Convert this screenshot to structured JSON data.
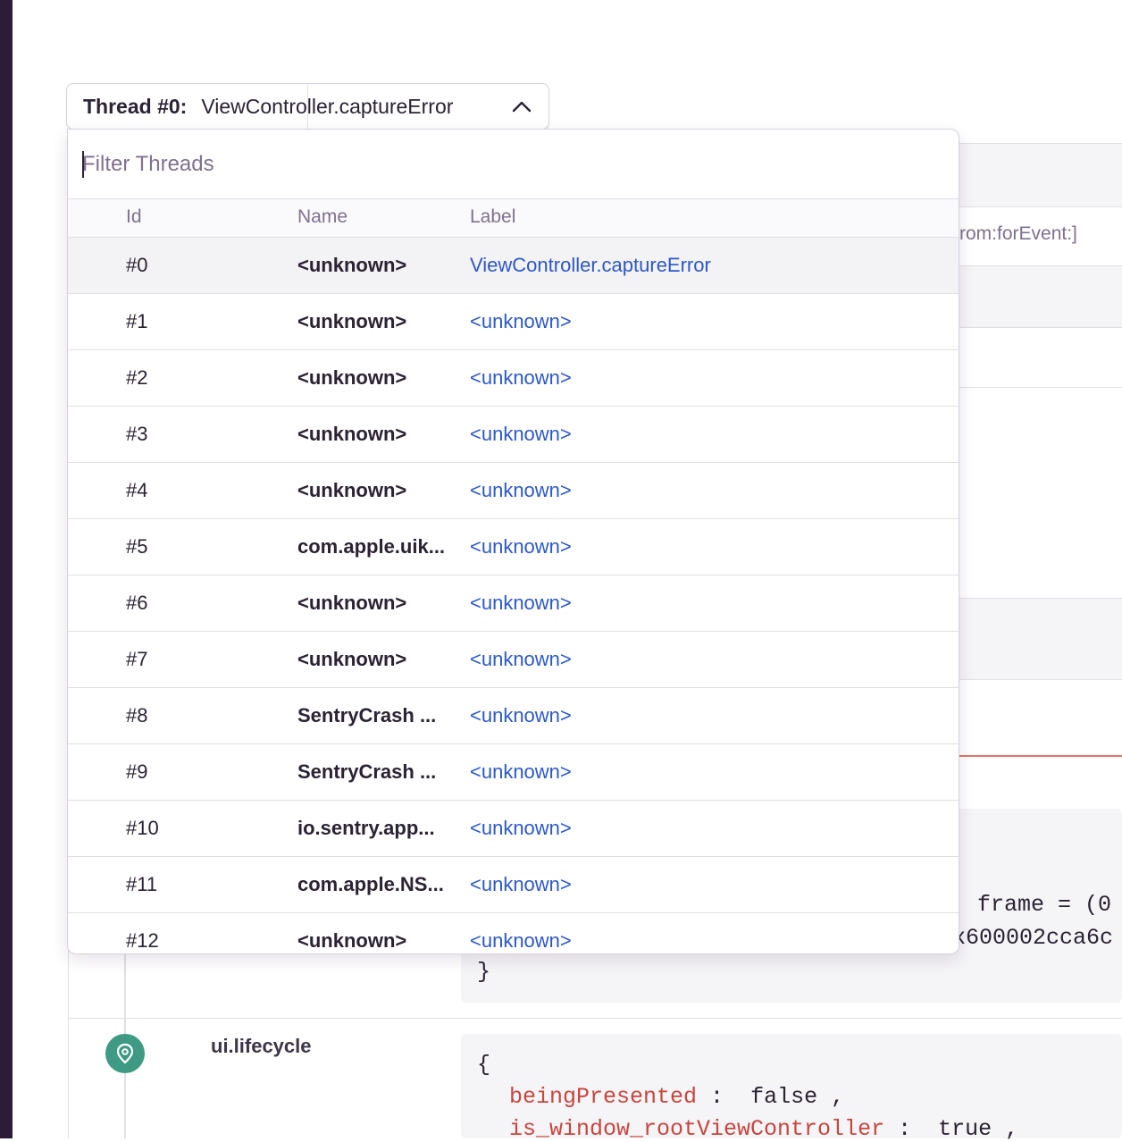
{
  "thread_selector": {
    "label": "Thread #0:",
    "value": "ViewController.captureError"
  },
  "dropdown": {
    "filter_placeholder": "Filter Threads",
    "columns": {
      "id": "Id",
      "name": "Name",
      "label": "Label"
    },
    "rows": [
      {
        "id": "#0",
        "name": "<unknown>",
        "label": "ViewController.captureError",
        "selected": true
      },
      {
        "id": "#1",
        "name": "<unknown>",
        "label": "<unknown>"
      },
      {
        "id": "#2",
        "name": "<unknown>",
        "label": "<unknown>"
      },
      {
        "id": "#3",
        "name": "<unknown>",
        "label": "<unknown>"
      },
      {
        "id": "#4",
        "name": "<unknown>",
        "label": "<unknown>"
      },
      {
        "id": "#5",
        "name": "com.apple.uik...",
        "label": "<unknown>"
      },
      {
        "id": "#6",
        "name": "<unknown>",
        "label": "<unknown>"
      },
      {
        "id": "#7",
        "name": "<unknown>",
        "label": "<unknown>"
      },
      {
        "id": "#8",
        "name": "SentryCrash ...",
        "label": "<unknown>"
      },
      {
        "id": "#9",
        "name": "SentryCrash ...",
        "label": "<unknown>"
      },
      {
        "id": "#10",
        "name": "io.sentry.app...",
        "label": "<unknown>"
      },
      {
        "id": "#11",
        "name": "com.apple.NS...",
        "label": "<unknown>"
      },
      {
        "id": "#12",
        "name": "<unknown>",
        "label": "<unknown>"
      }
    ]
  },
  "background": {
    "frame_fragment": "rom:forEvent:]",
    "code_line1": "frame = (0",
    "code_line2": "x600002cca6c",
    "code_close": "}",
    "breadcrumb_title": "ui.lifecycle",
    "code2_open": "{",
    "code2_key1": "beingPresented",
    "code2_val1": "false",
    "code2_key2": "is_window_rootViewController",
    "code2_val2": "true"
  },
  "colors": {
    "accent_link": "#2c58c8",
    "crumb_icon": "#3f9a84",
    "code_key": "#c8463f"
  }
}
